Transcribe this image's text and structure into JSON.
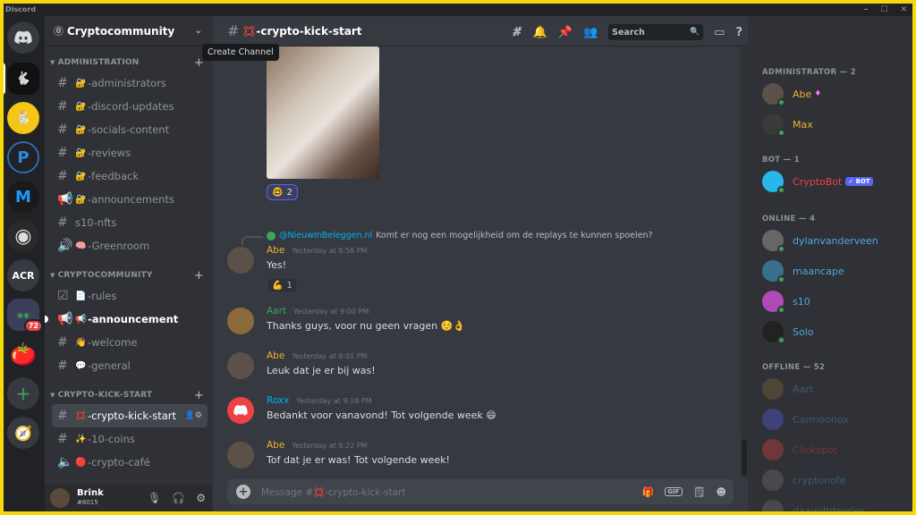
{
  "app": {
    "title": "Discord"
  },
  "window_controls": [
    "–",
    "☐",
    "✕"
  ],
  "servers": [
    {
      "name": "Crypto Community",
      "color": "#111111",
      "label": ""
    },
    {
      "name": "Server 2",
      "color": "#f5c518",
      "label": ""
    },
    {
      "name": "Server 3",
      "color": "#2b6cb0",
      "label": "P"
    },
    {
      "name": "Server 4",
      "color": "#1a9cff",
      "label": "M"
    },
    {
      "name": "Server 5",
      "color": "#444444",
      "label": "◉"
    },
    {
      "name": "ACR",
      "color": "#36393f",
      "label": "ACR"
    },
    {
      "name": "Folder",
      "color": "#2f3136",
      "label": "",
      "badge": "72"
    },
    {
      "name": "Tomato",
      "color": "#d63a2a",
      "label": ""
    }
  ],
  "guild": {
    "name": "Cryptocommunity",
    "count": "0",
    "tooltip": "Create Channel"
  },
  "categories": [
    {
      "name": "ADMINISTRATION",
      "channels": [
        {
          "name": "-administrators",
          "emoji": "🔐",
          "type": "text"
        },
        {
          "name": "-discord-updates",
          "emoji": "🔐",
          "type": "text"
        },
        {
          "name": "-socials-content",
          "emoji": "🔐",
          "type": "text"
        },
        {
          "name": "-reviews",
          "emoji": "🔐",
          "type": "text"
        },
        {
          "name": "-feedback",
          "emoji": "🔐",
          "type": "text"
        },
        {
          "name": "-announcements",
          "emoji": "🔐",
          "type": "announce"
        },
        {
          "name": "s10-nfts",
          "emoji": "",
          "type": "text"
        },
        {
          "name": "-Greenroom",
          "emoji": "🧠",
          "type": "stage"
        }
      ]
    },
    {
      "name": "CRYPTOCOMMUNITY",
      "channels": [
        {
          "name": "-rules",
          "emoji": "📄",
          "type": "rules"
        },
        {
          "name": "-announcement",
          "emoji": "📢",
          "type": "announce"
        },
        {
          "name": "-welcome",
          "emoji": "👋",
          "type": "text"
        },
        {
          "name": "-general",
          "emoji": "💬",
          "type": "text"
        }
      ]
    },
    {
      "name": "CRYPTO-KICK-START",
      "channels": [
        {
          "name": "-crypto-kick-start",
          "emoji": "💢",
          "type": "text"
        },
        {
          "name": "-10-coins",
          "emoji": "✨",
          "type": "text"
        },
        {
          "name": "-crypto-café",
          "emoji": "🔴",
          "type": "voice"
        }
      ]
    }
  ],
  "user": {
    "name": "Brink",
    "tag": "#6015"
  },
  "channel": {
    "name": "-crypto-kick-start",
    "emoji": "💢"
  },
  "header": {
    "search_placeholder": "Search"
  },
  "reactions": {
    "image": {
      "emoji": "🤓",
      "count": "2"
    },
    "abe": {
      "emoji": "💪",
      "count": "1"
    }
  },
  "reply": {
    "mention": "@NieuwInBeleggen.nl",
    "text": "Komt er nog een mogelijkheid om de replays te kunnen spoelen?"
  },
  "messages": [
    {
      "author": "Abe",
      "time": "Yesterday at 8:58 PM",
      "text": "Yes!",
      "color": "#f0b232"
    },
    {
      "author": "Aart",
      "time": "Yesterday at 9:00 PM",
      "text": "Thanks guys, voor nu geen vragen ☺️👌",
      "color": "#3ba55d"
    },
    {
      "author": "Abe",
      "time": "Yesterday at 9:01 PM",
      "text": "Leuk dat je er bij was!",
      "color": "#f0b232"
    },
    {
      "author": "Roxx",
      "time": "Yesterday at 9:18 PM",
      "text": "Bedankt voor vanavond! Tot volgende week 😄",
      "color": "#00b0f4"
    },
    {
      "author": "Abe",
      "time": "Yesterday at 9:22 PM",
      "text": "Tof dat je er was! Tot volgende week!",
      "color": "#f0b232"
    }
  ],
  "composer": {
    "placeholder": "Message #💢-crypto-kick-start"
  },
  "members": {
    "groups": [
      {
        "title": "ADMINISTRATOR — 2",
        "items": [
          {
            "name": "Abe",
            "color": "#f0b232",
            "suffix": "♦"
          },
          {
            "name": "Max",
            "color": "#f0b232"
          }
        ]
      },
      {
        "title": "BOT — 1",
        "items": [
          {
            "name": "CryptoBot",
            "color": "#ed4245",
            "badge": "✓ BOT"
          }
        ]
      },
      {
        "title": "ONLINE — 4",
        "items": [
          {
            "name": "dylanvanderveen",
            "color": "#4ea8de"
          },
          {
            "name": "maancape",
            "color": "#4ea8de"
          },
          {
            "name": "s10",
            "color": "#4ea8de"
          },
          {
            "name": "Solo",
            "color": "#4ea8de"
          }
        ]
      },
      {
        "title": "OFFLINE — 52",
        "items": [
          {
            "name": "Aart",
            "color": "#4ea8de"
          },
          {
            "name": "Carmoonox",
            "color": "#4ea8de"
          },
          {
            "name": "Clickspot",
            "color": "#ed4245"
          },
          {
            "name": "cryptonofe",
            "color": "#4ea8de"
          },
          {
            "name": "daavidtdevries",
            "color": "#4ea8de"
          }
        ]
      }
    ]
  }
}
